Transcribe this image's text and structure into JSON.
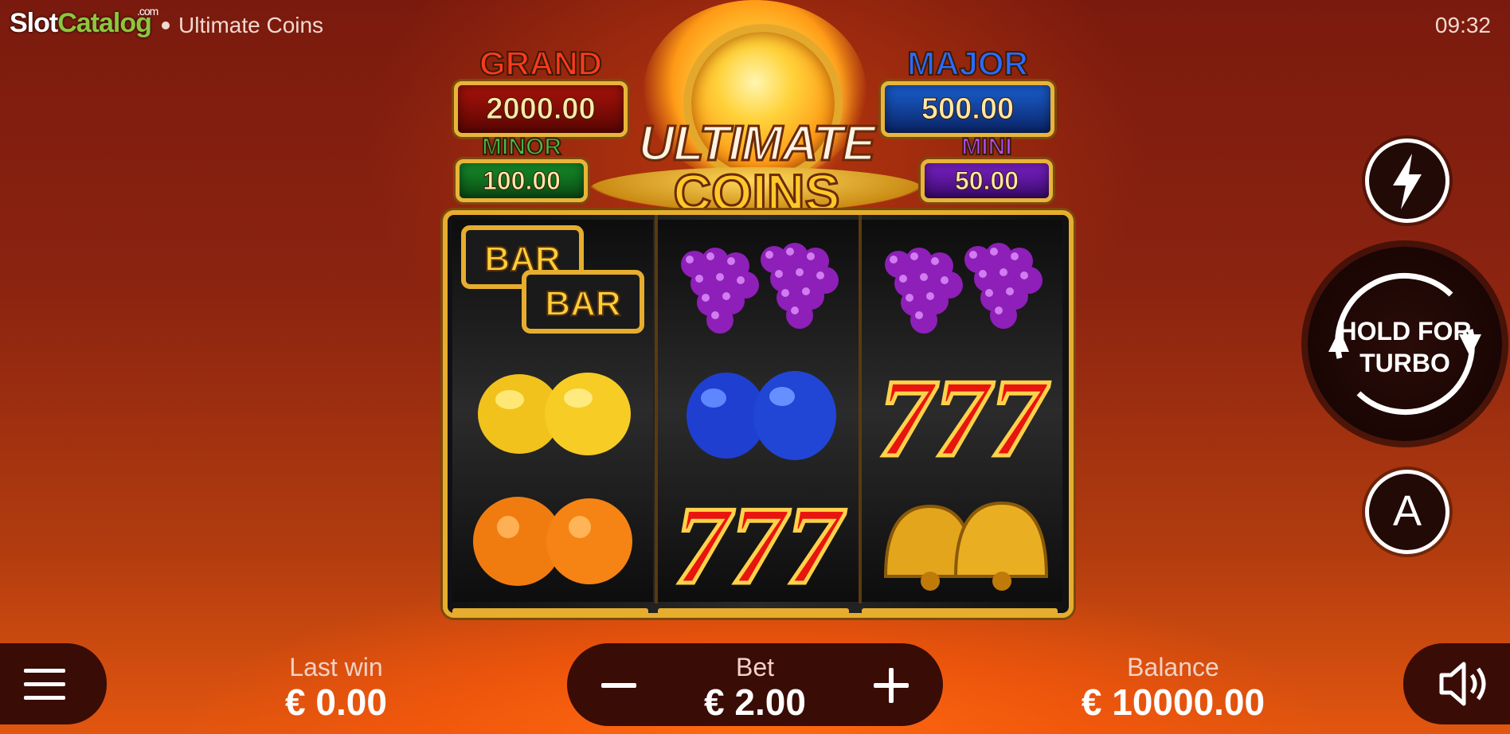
{
  "watermark": {
    "brand_a": "Slot",
    "brand_b": "Catalog",
    "tld": ".com"
  },
  "header": {
    "game_title": "Ultimate Coins",
    "clock": "09:32"
  },
  "logo": {
    "line1": "ULTIMATE",
    "line2": "COINS"
  },
  "jackpots": {
    "grand": {
      "label": "GRAND",
      "value": "2000.00",
      "color": "#ff3a1c"
    },
    "major": {
      "label": "MAJOR",
      "value": "500.00",
      "color": "#2a6cff"
    },
    "minor": {
      "label": "MINOR",
      "value": "100.00",
      "color": "#46c04a"
    },
    "mini": {
      "label": "MINI",
      "value": "50.00",
      "color": "#b450ff"
    }
  },
  "reels": [
    [
      "bar-bar",
      "lemons",
      "oranges"
    ],
    [
      "grapes",
      "plums",
      "sevens"
    ],
    [
      "grapes",
      "sevens",
      "bells"
    ]
  ],
  "symbols": {
    "bar_text": "BAR"
  },
  "controls": {
    "turbo_icon": "lightning-icon",
    "spin_label_1": "HOLD FOR",
    "spin_label_2": "TURBO",
    "auto_label": "A"
  },
  "bottom": {
    "last_win_label": "Last win",
    "last_win_value": "€ 0.00",
    "bet_label": "Bet",
    "bet_value": "€ 2.00",
    "balance_label": "Balance",
    "balance_value": "€ 10000.00"
  },
  "colors": {
    "accent_gold": "#e6ad2f",
    "background": "#8c2410"
  }
}
